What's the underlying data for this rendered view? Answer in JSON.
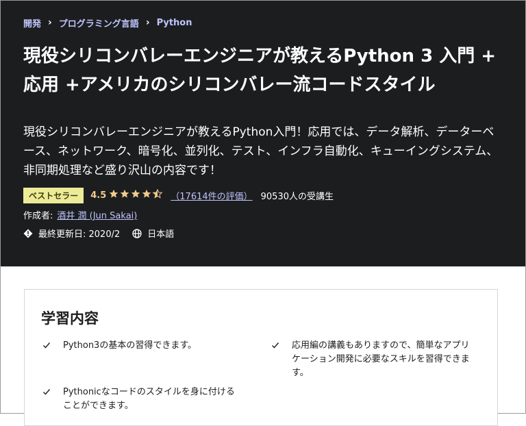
{
  "breadcrumb": {
    "items": [
      "開発",
      "プログラミング言語",
      "Python"
    ],
    "separator": "›"
  },
  "course": {
    "title": "現役シリコンバレーエンジニアが教えるPython 3 入門 + 応用 +アメリカのシリコンバレー流コードスタイル",
    "subtitle": "現役シリコンバレーエンジニアが教えるPython入門！応用では、データ解析、データーベース、ネットワーク、暗号化、並列化、テスト、インフラ自動化、キューイングシステム、非同期処理など盛り沢山の内容です！",
    "badge": "ベストセラー",
    "rating": "4.5",
    "stars_value": 4.5,
    "ratings_count": "（17614件の評価）",
    "students": "90530人の受講生",
    "author_label": "作成者:",
    "author_name": "酒井 潤 (Jun Sakai)",
    "last_updated": "最終更新日: 2020/2",
    "language": "日本語"
  },
  "learn": {
    "title": "学習内容",
    "items": [
      "Python3の基本の習得できます。",
      "応用編の講義もありますので、簡単なアプリケーション開発に必要なスキルを習得できます。",
      "Pythonicなコードのスタイルを身に付けることができます。"
    ]
  },
  "colors": {
    "hero_bg": "#1c1d1f",
    "link": "#c0c4fc",
    "star": "#f3ca8c",
    "badge_bg": "#eceb98"
  },
  "icons": [
    "chevron-right-icon",
    "star-icon",
    "alert-icon",
    "globe-icon",
    "check-icon"
  ]
}
